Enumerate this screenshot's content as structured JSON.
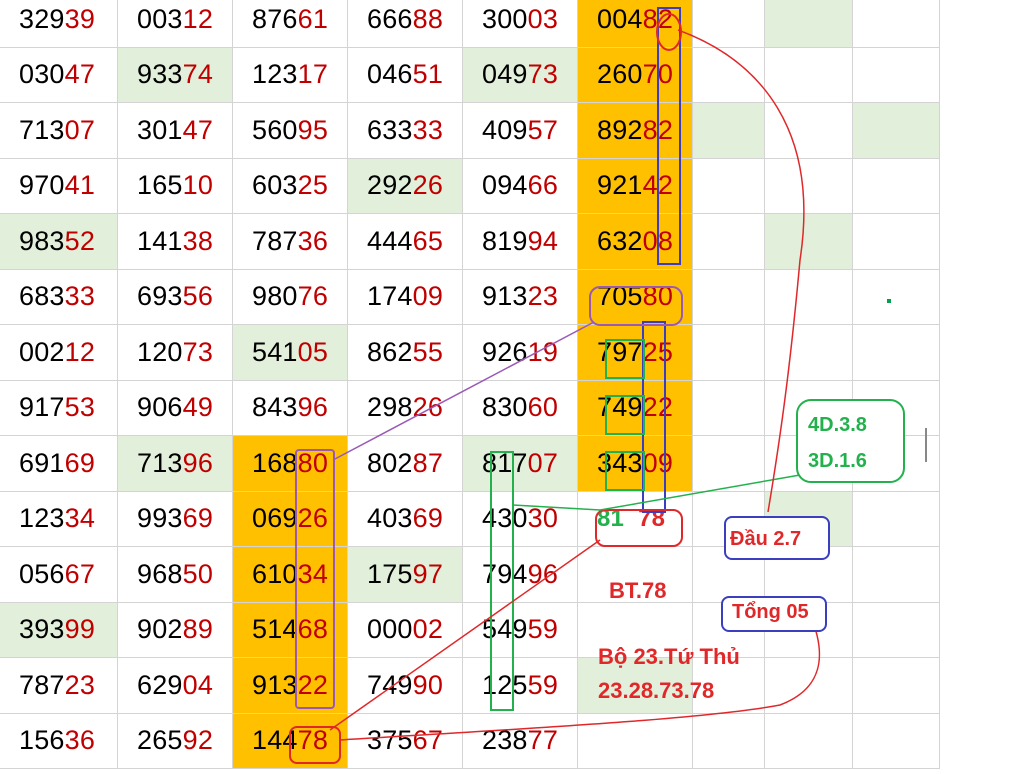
{
  "sheet": {
    "rows": [
      [
        "32939",
        "00312",
        "87661",
        "66688",
        "30003",
        "00482",
        "",
        "",
        ""
      ],
      [
        "03047",
        "93374",
        "12317",
        "04651",
        "04973",
        "26070",
        "",
        "",
        ""
      ],
      [
        "71307",
        "30147",
        "56095",
        "63333",
        "40957",
        "89282",
        "",
        "",
        ""
      ],
      [
        "97041",
        "16510",
        "60325",
        "29226",
        "09466",
        "92142",
        "",
        "",
        ""
      ],
      [
        "98352",
        "14138",
        "78736",
        "44465",
        "81994",
        "63208",
        "",
        "",
        ""
      ],
      [
        "68333",
        "69356",
        "98076",
        "17409",
        "91323",
        "70580",
        "",
        "",
        ""
      ],
      [
        "00212",
        "12073",
        "54105",
        "86255",
        "92619",
        "79725",
        "",
        "",
        ""
      ],
      [
        "91753",
        "90649",
        "84396",
        "29826",
        "83060",
        "74922",
        "",
        "",
        ""
      ],
      [
        "69169",
        "71396",
        "16880",
        "80287",
        "81707",
        "34309",
        "",
        "",
        ""
      ],
      [
        "12334",
        "99369",
        "06926",
        "40369",
        "43030",
        "8178",
        "",
        "",
        ""
      ],
      [
        "05667",
        "96850",
        "61034",
        "17597",
        "79496",
        "",
        "",
        "",
        ""
      ],
      [
        "39399",
        "90289",
        "51468",
        "00002",
        "54959",
        "",
        "",
        "",
        ""
      ],
      [
        "78723",
        "62904",
        "91322",
        "74990",
        "12559",
        "",
        "",
        "",
        ""
      ],
      [
        "15636",
        "26592",
        "14478",
        "37567",
        "23877",
        "",
        "",
        "",
        ""
      ]
    ],
    "fills": [
      [
        "",
        "",
        "",
        "",
        "",
        "orange",
        "",
        "green",
        ""
      ],
      [
        "",
        "green",
        "",
        "",
        "green",
        "orange",
        "",
        "",
        ""
      ],
      [
        "",
        "",
        "",
        "",
        "",
        "orange",
        "green",
        "",
        "green"
      ],
      [
        "",
        "",
        "",
        "green",
        "",
        "orange",
        "",
        "",
        ""
      ],
      [
        "green",
        "",
        "",
        "",
        "",
        "orange",
        "",
        "green",
        ""
      ],
      [
        "",
        "",
        "",
        "",
        "",
        "orange",
        "",
        "",
        ""
      ],
      [
        "",
        "",
        "green",
        "",
        "",
        "orange",
        "",
        "",
        ""
      ],
      [
        "",
        "",
        "",
        "",
        "",
        "orange",
        "",
        "",
        ""
      ],
      [
        "",
        "green",
        "orange",
        "",
        "green",
        "orange",
        "",
        "",
        ""
      ],
      [
        "",
        "",
        "orange",
        "",
        "",
        "",
        "",
        "green",
        ""
      ],
      [
        "",
        "",
        "orange",
        "green",
        "",
        "",
        "",
        "",
        ""
      ],
      [
        "green",
        "",
        "orange",
        "",
        "",
        "",
        "",
        "",
        ""
      ],
      [
        "",
        "",
        "orange",
        "",
        "",
        "green",
        "",
        "",
        ""
      ],
      [
        "",
        "",
        "orange",
        "",
        "",
        "",
        "",
        "",
        ""
      ]
    ]
  },
  "annotations": {
    "combo_line1": "4D.3.8",
    "combo_line2": "3D.1.6",
    "dau": "Đầu 2.7",
    "bt": "BT.78",
    "tong": "Tổng 05",
    "bo": "Bộ 23.Tứ Thủ",
    "bo_numbers": "23.28.73.78",
    "pair_left": "81",
    "pair_right": "78"
  },
  "colors": {
    "tail_digits": "#c00000",
    "highlight_orange": "#ffc000",
    "highlight_green": "#e2efda",
    "annot_red": "#e0282a",
    "annot_green": "#22b14c",
    "annot_blue": "#3b3fbf",
    "annot_purple": "#9b59b6"
  }
}
